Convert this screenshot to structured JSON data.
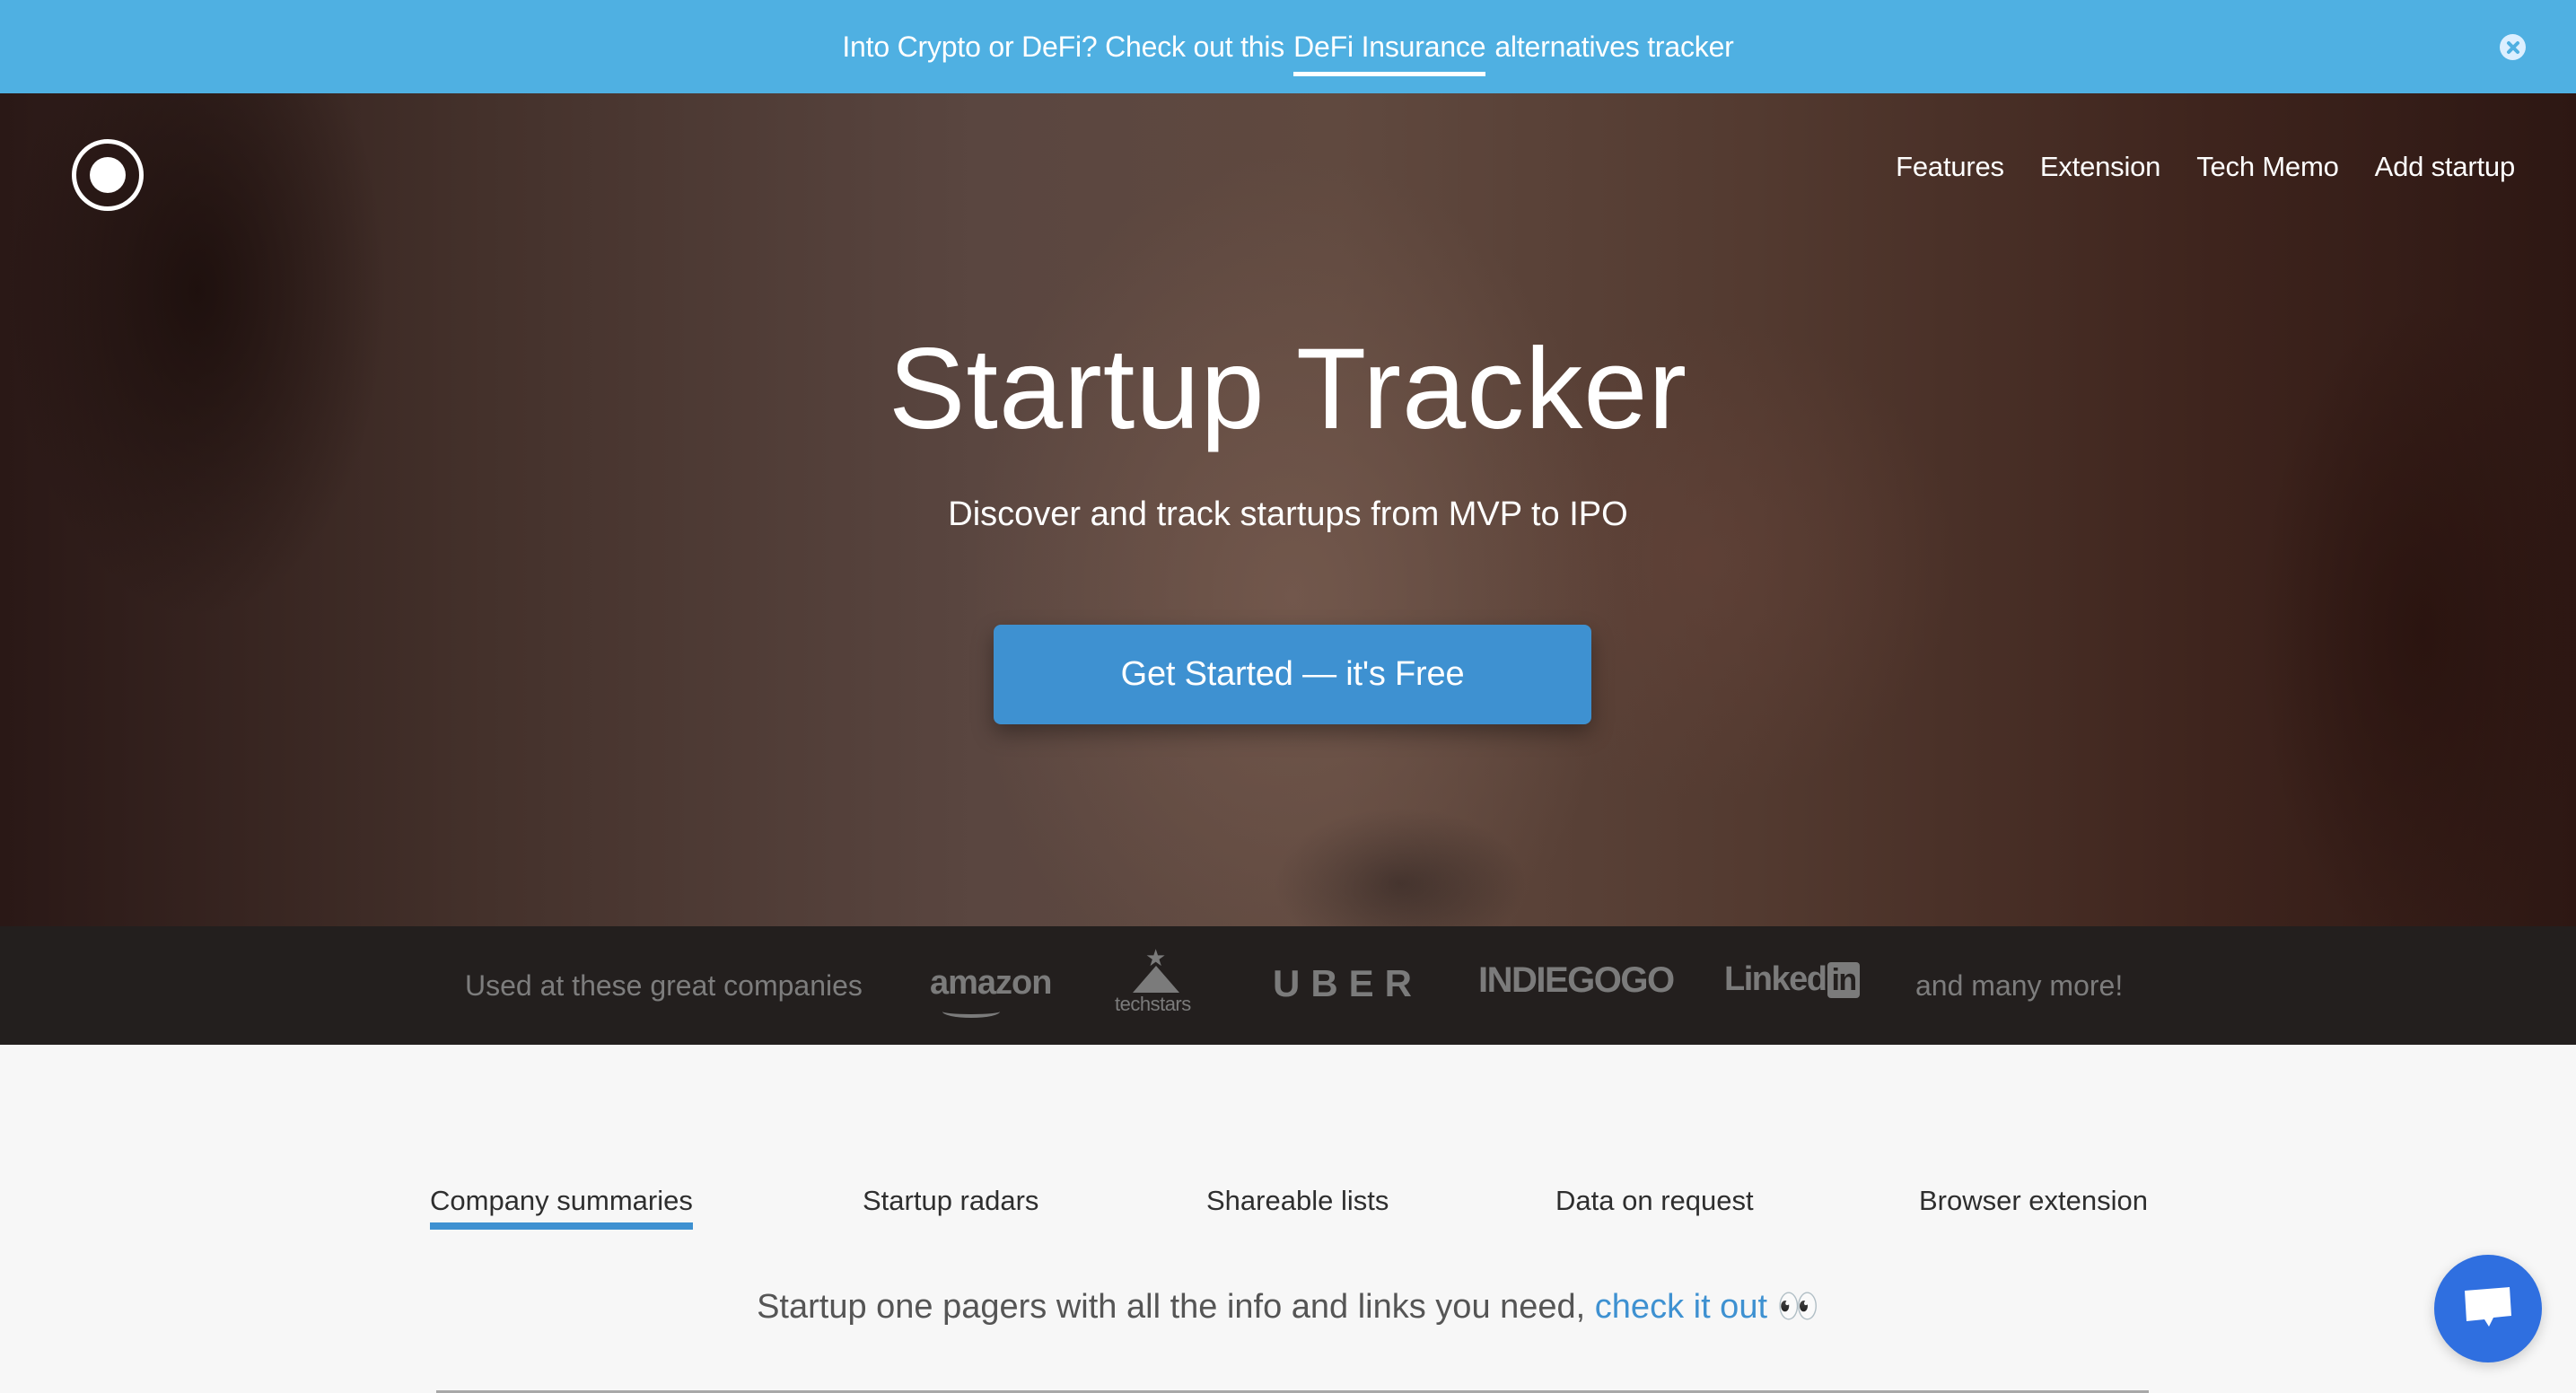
{
  "announcement": {
    "prefix": "Into Crypto or DeFi? Check out this",
    "link_text": "DeFi Insurance",
    "suffix": "alternatives tracker",
    "close_icon": "close-circle-icon"
  },
  "header": {
    "logo_icon": "circle-dot-logo",
    "nav": [
      {
        "label": "Features"
      },
      {
        "label": "Extension"
      },
      {
        "label": "Tech Memo"
      },
      {
        "label": "Add startup"
      }
    ]
  },
  "hero": {
    "title": "Startup Tracker",
    "subtitle": "Discover and track startups from MVP to IPO",
    "cta_label": "Get Started — it's Free"
  },
  "companies": {
    "intro": "Used at these great companies",
    "logos": {
      "amazon": "amazon",
      "techstars": "techstars",
      "uber": "UBER",
      "indiegogo": "INDIEGOGO",
      "linkedin_word": "Linked",
      "linkedin_badge": "in"
    },
    "outro": "and many more!"
  },
  "features": {
    "tabs": [
      {
        "label": "Company summaries",
        "active": true
      },
      {
        "label": "Startup radars",
        "active": false
      },
      {
        "label": "Shareable lists",
        "active": false
      },
      {
        "label": "Data on request",
        "active": false
      },
      {
        "label": "Browser extension",
        "active": false
      }
    ],
    "tagline_text": "Startup one pagers with all the info and links you need,",
    "tagline_link": "check it out",
    "tagline_emoji": "👀"
  },
  "chat": {
    "icon": "chat-bubble-icon"
  },
  "colors": {
    "banner": "#4fb0e2",
    "accent": "#3e91d1",
    "logos_bar": "#231f1e",
    "chat": "#2f6fe0"
  }
}
